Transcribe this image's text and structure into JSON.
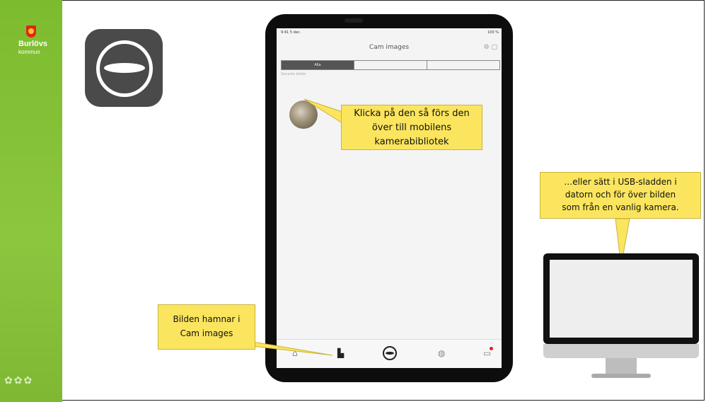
{
  "branding": {
    "name": "Burlövs",
    "sub": "kommun"
  },
  "app": {
    "status_left": "9:41 5 dec.",
    "status_right": "100 %",
    "title": "Cam images",
    "segments": [
      "Alla"
    ],
    "section_label": "Senaste bilder",
    "tabs": [
      "home-icon",
      "folder-icon",
      "camera-icon",
      "globe-icon",
      "inbox-icon"
    ]
  },
  "callouts": {
    "tap_thumbnail": {
      "lines": [
        "Klicka på den så förs den",
        "över till mobilens",
        "kamerabibliotek"
      ]
    },
    "usb_cable": {
      "lines": [
        "…eller sätt i USB-sladden i",
        "datorn och för över bilden",
        "som från en vanlig kamera."
      ]
    },
    "image_lands": {
      "lines": [
        "Bilden hamnar i",
        "Cam images"
      ]
    }
  },
  "colors": {
    "sidebar_green": "#8cc63f",
    "callout_yellow": "#fbe55e",
    "app_icon_grey": "#4a4a4a"
  }
}
